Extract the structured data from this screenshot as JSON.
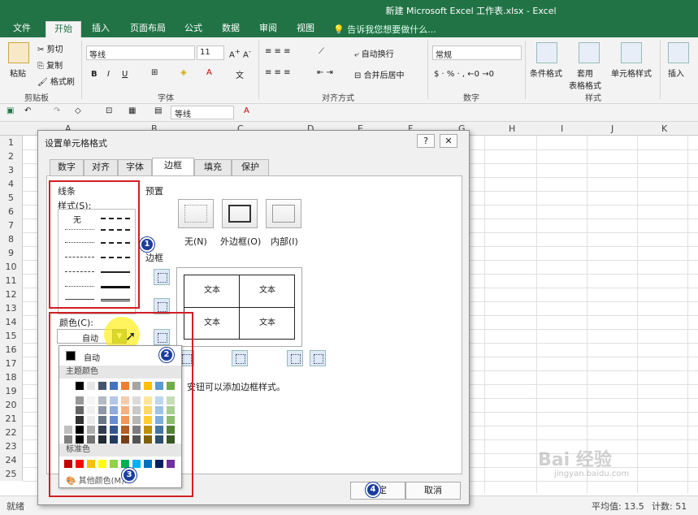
{
  "window": {
    "title": "新建 Microsoft Excel 工作表.xlsx - Excel"
  },
  "tabs": [
    "文件",
    "开始",
    "插入",
    "页面布局",
    "公式",
    "数据",
    "审阅",
    "视图"
  ],
  "tell_me": "告诉我您想要做什么...",
  "ribbon": {
    "paste": "粘贴",
    "cut": "剪切",
    "copy": "复制",
    "format_painter": "格式刷",
    "clipboard_label": "剪贴板",
    "font_name": "等线",
    "font_size": "11",
    "font_label": "字体",
    "wrap_text": "自动换行",
    "merge_center": "合并后居中",
    "alignment_label": "对齐方式",
    "number_format": "常规",
    "number_label": "数字",
    "conditional_format": "条件格式",
    "format_as_table": "套用\n表格格式",
    "cell_styles": "单元格样式",
    "styles_label": "样式",
    "insert": "插入",
    "bold": "B",
    "italic": "I",
    "underline": "U"
  },
  "qat": {
    "font_name": "等线"
  },
  "columns": [
    "A",
    "B",
    "C",
    "D",
    "E",
    "F",
    "G",
    "H",
    "I",
    "J",
    "K"
  ],
  "rows": [
    "1",
    "2",
    "3",
    "4",
    "5",
    "6",
    "7",
    "8",
    "9",
    "10",
    "11",
    "12",
    "13",
    "14",
    "15",
    "16",
    "17",
    "18",
    "19",
    "20",
    "21",
    "22",
    "23",
    "24",
    "25"
  ],
  "status": {
    "ready": "就绪",
    "average": "平均值: 13.5",
    "count": "计数: 51"
  },
  "dialog": {
    "title": "设置单元格格式",
    "help": "?",
    "close": "✕",
    "tabs": [
      "数字",
      "对齐",
      "字体",
      "边框",
      "填充",
      "保护"
    ],
    "active_tab": "边框",
    "line_section": "线条",
    "style_label": "样式(S):",
    "style_none": "无",
    "preset_section": "预置",
    "preset_none": "无(N)",
    "preset_outline": "外边框(O)",
    "preset_inside": "内部(I)",
    "border_section": "边框",
    "preview_text": "文本",
    "color_label": "颜色(C):",
    "color_value": "自动",
    "hint": "单击预置选项、预览草图及上面的按钮可以添加边框样式。",
    "hint_visible": "安钮可以添加边框样式。",
    "ok": "确定",
    "cancel": "取消"
  },
  "palette": {
    "auto": "自动",
    "theme_section": "主题颜色",
    "standard_section": "标准色",
    "more_colors": "其他颜色(M)...",
    "theme_top": [
      "#ffffff",
      "#000000",
      "#e7e6e6",
      "#44546a",
      "#4472c4",
      "#ed7d31",
      "#a5a5a5",
      "#ffc000",
      "#5b9bd5",
      "#70ad47"
    ],
    "standard": [
      "#c00000",
      "#ff0000",
      "#ffc000",
      "#ffff00",
      "#92d050",
      "#00b050",
      "#00b0f0",
      "#0070c0",
      "#002060",
      "#7030a0"
    ]
  },
  "annotations": [
    "1",
    "2",
    "3",
    "4"
  ],
  "watermark": {
    "brand": "Bai 经验",
    "url": "jingyan.baidu.com"
  }
}
